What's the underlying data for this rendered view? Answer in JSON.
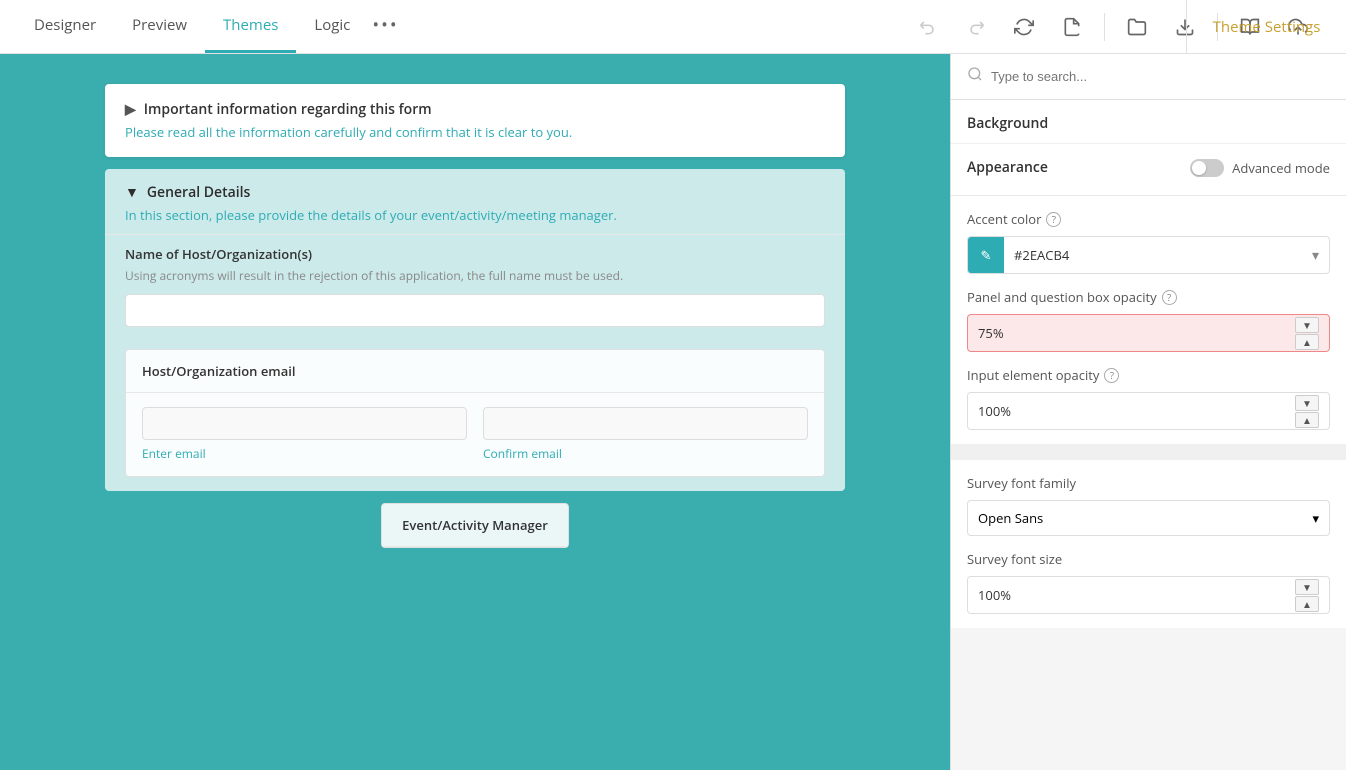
{
  "nav": {
    "tabs": [
      {
        "id": "designer",
        "label": "Designer",
        "active": false
      },
      {
        "id": "preview",
        "label": "Preview",
        "active": false
      },
      {
        "id": "themes",
        "label": "Themes",
        "active": true
      },
      {
        "id": "logic",
        "label": "Logic",
        "active": false
      }
    ],
    "theme_settings_label": "Theme Settings"
  },
  "toolbar": {
    "undo_label": "undo",
    "redo_label": "redo",
    "refresh_label": "refresh",
    "fill_label": "fill",
    "open_label": "open",
    "download_label": "download",
    "book_label": "book",
    "upload_label": "upload"
  },
  "form": {
    "info_card": {
      "title": "Important information regarding this form",
      "subtitle": "Please read all the information carefully and confirm that it is clear to you."
    },
    "general_details": {
      "title": "General Details",
      "subtitle": "In this section, please provide the details of your event/activity/meeting manager.",
      "host_field": {
        "label": "Name of Host/Organization(s)",
        "sublabel": "Using acronyms will result in the rejection of this application, the full name must be used."
      },
      "email_section": {
        "title": "Host/Organization email",
        "enter_email_placeholder": "Enter email",
        "confirm_email_placeholder": "Confirm email"
      },
      "event_section": {
        "title": "Event/Activity Manager"
      }
    }
  },
  "right_panel": {
    "search_placeholder": "Type to search...",
    "background_label": "Background",
    "appearance": {
      "title": "Appearance",
      "advanced_mode_label": "Advanced mode",
      "toggle_state": "off"
    },
    "settings": {
      "accent_color": {
        "label": "Accent color",
        "value": "#2EACB4",
        "color": "#2EACB4"
      },
      "panel_opacity": {
        "label": "Panel and question box opacity",
        "value": "75%",
        "highlighted": true
      },
      "input_opacity": {
        "label": "Input element opacity",
        "value": "100%"
      },
      "font_family": {
        "label": "Survey font family",
        "value": "Open Sans"
      },
      "font_size": {
        "label": "Survey font size",
        "value": "100%"
      }
    }
  }
}
